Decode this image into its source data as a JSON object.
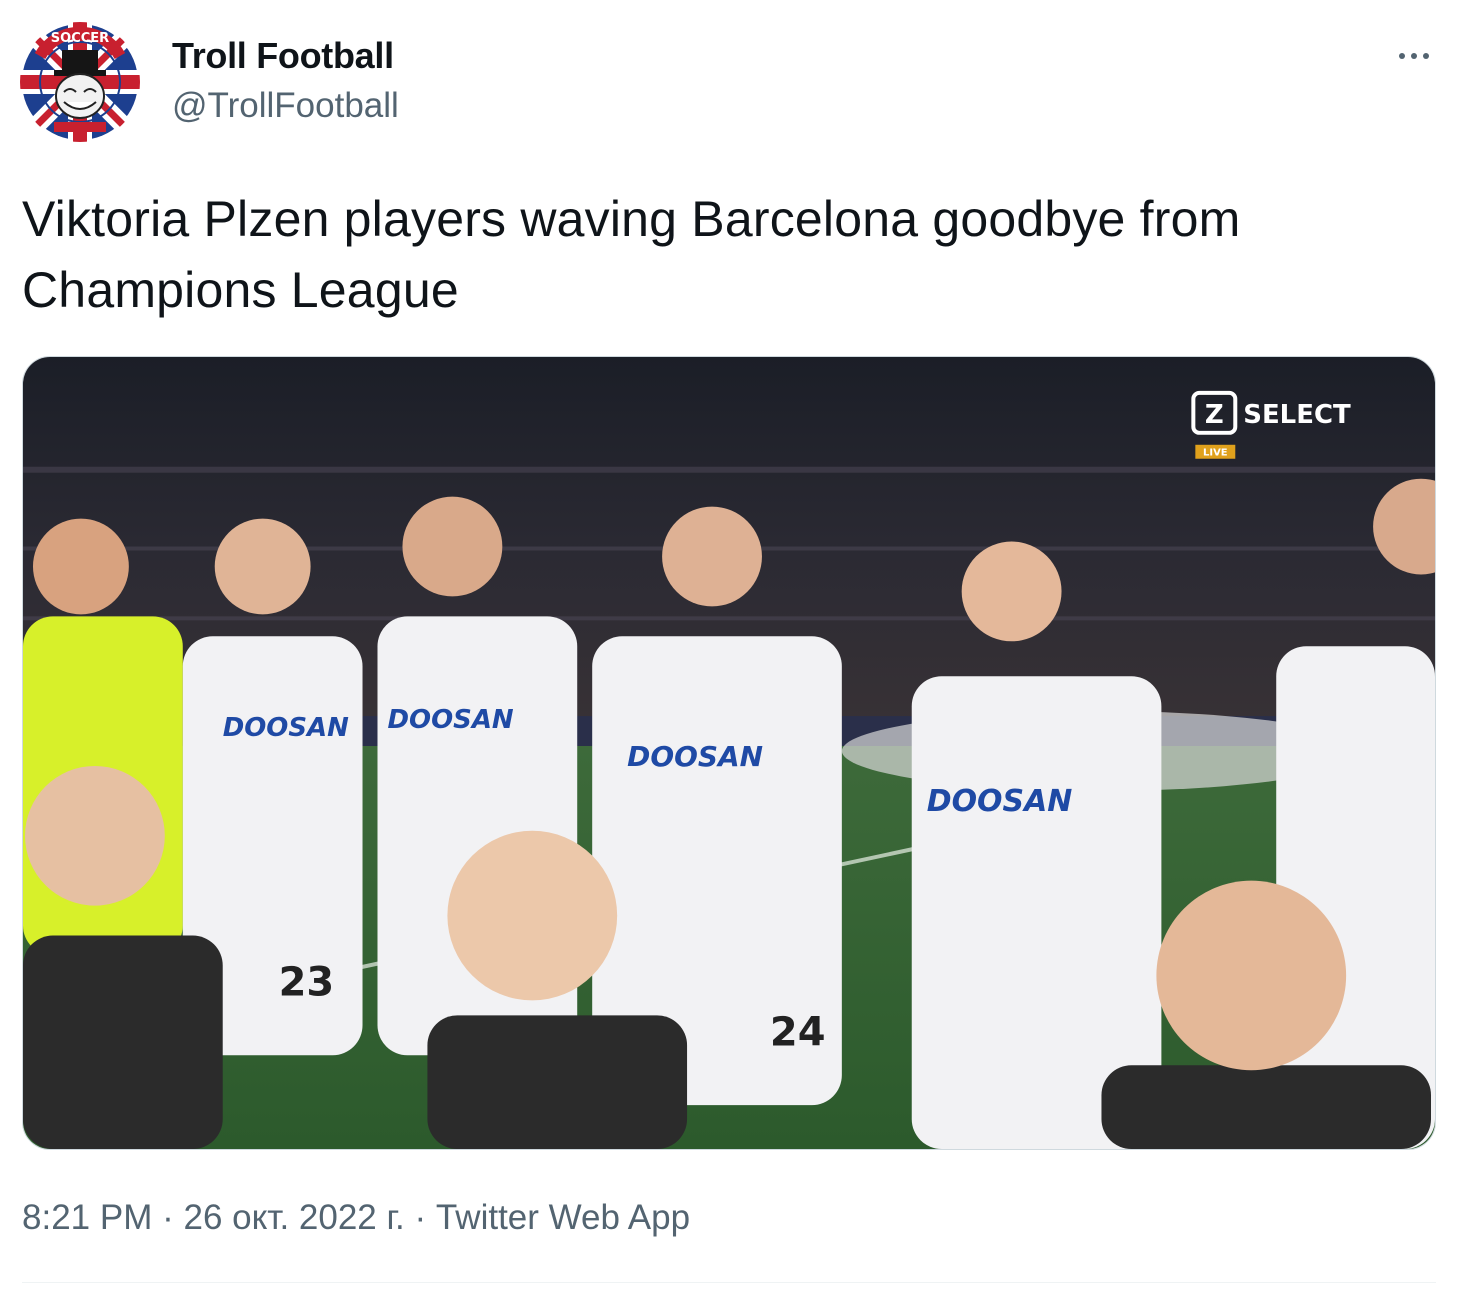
{
  "tweet": {
    "author": {
      "display_name": "Troll Football",
      "handle": "@TrollFootball",
      "avatar_icon": "troll-face-union-jack-badge-icon",
      "avatar_text": "SOCCER"
    },
    "more_icon": "more-horizontal-icon",
    "text": "Viktoria Plzen players waving Barcelona goodbye from Champions League",
    "media": {
      "broadcaster_logo": "SELECT",
      "live_badge": "LIVE",
      "sponsor_text": "DOOSAN",
      "numbers": [
        "23",
        "24"
      ]
    },
    "meta": {
      "time": "8:21 PM",
      "date": "26 окт. 2022 г.",
      "separator": "·",
      "source": "Twitter Web App"
    },
    "colors": {
      "text": "#0f1419",
      "secondary": "#536471",
      "border": "#cfd9de"
    }
  }
}
